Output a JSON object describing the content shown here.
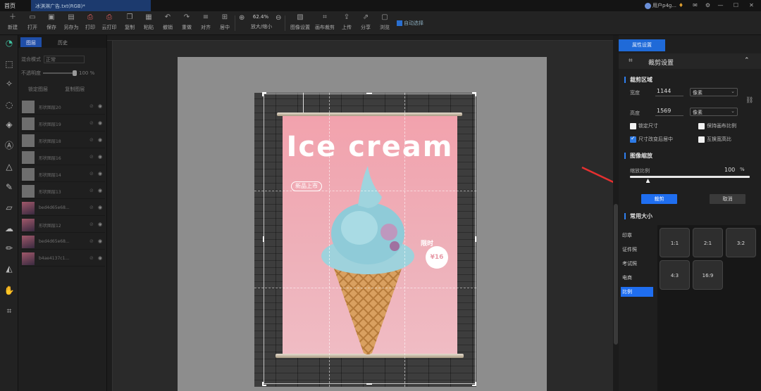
{
  "titlebar": {
    "home": "首页",
    "doc_tab": "冰淇淋广告.txt(RGB)*",
    "user": "用户p4g..."
  },
  "toolbar": {
    "items": [
      "新建",
      "打开",
      "保存",
      "另存为",
      "打印",
      "云打印",
      "复制",
      "粘贴",
      "撤销",
      "重做",
      "对齐",
      "居中",
      "放大/缩小",
      "图像设置",
      "画布裁剪",
      "上传",
      "分享",
      "浏览"
    ],
    "zoom": "62.4%",
    "auto_select": "自动选择"
  },
  "layers_panel": {
    "tabs": [
      "图层",
      "历史"
    ],
    "blend_label": "混合模式",
    "blend_value": "正常",
    "opacity_label": "不透明度",
    "opacity_value": "100 %",
    "btn_lock": "锁定图层",
    "btn_copy": "复制图层",
    "layers": [
      {
        "name": "形状图层20",
        "thumb": "plain"
      },
      {
        "name": "形状图层19",
        "thumb": "plain"
      },
      {
        "name": "形状图层18",
        "thumb": "plain"
      },
      {
        "name": "形状图层16",
        "thumb": "plain"
      },
      {
        "name": "形状图层14",
        "thumb": "plain"
      },
      {
        "name": "形状图层13",
        "thumb": "plain"
      },
      {
        "name": "bed4d65e68...",
        "thumb": "image"
      },
      {
        "name": "形状图层12",
        "thumb": "image"
      },
      {
        "name": "bed4d65e68...",
        "thumb": "image"
      },
      {
        "name": "b4ae4137c1...",
        "thumb": "image"
      }
    ]
  },
  "canvas": {
    "poster_title": "Ice cream",
    "badge": "新品上市",
    "limited": "限时",
    "price": "¥16"
  },
  "right_panel": {
    "tab": "属性设置",
    "header": "裁剪设置",
    "crop_area": {
      "title": "裁剪区域",
      "width_label": "宽度",
      "width_value": "1144",
      "height_label": "高度",
      "height_value": "1569",
      "unit": "像素"
    },
    "options": [
      {
        "label": "锁定尺寸",
        "checked": false
      },
      {
        "label": "保持画布比例",
        "checked": false
      },
      {
        "label": "尺寸改变后居中",
        "checked": true
      },
      {
        "label": "互换宽高比",
        "checked": false
      }
    ],
    "scale": {
      "title": "图像缩放",
      "label": "缩放比例",
      "value": "100",
      "unit": "%",
      "level": 0.15
    },
    "crop_button": "裁剪",
    "cancel_button": "取消",
    "common_sizes": {
      "title": "常用大小",
      "categories": [
        "印章",
        "证件照",
        "考试照",
        "电商",
        "比例"
      ],
      "active_category": "比例",
      "ratios": [
        "1:1",
        "2:1",
        "3:2",
        "4:3",
        "16:9"
      ]
    }
  },
  "colors": {
    "accent": "#1f6ef0",
    "poster_pink": "#f2a2ad",
    "annotation_red": "#e53030"
  }
}
